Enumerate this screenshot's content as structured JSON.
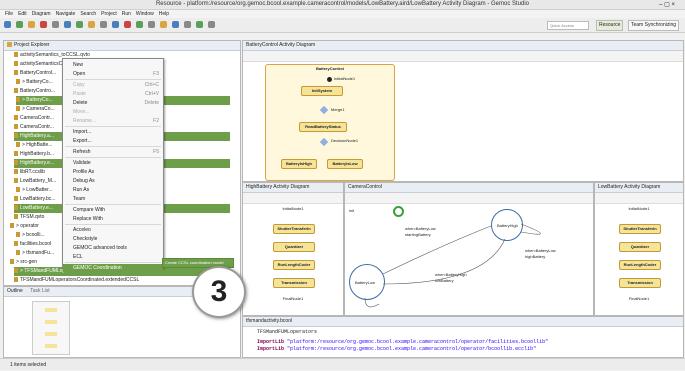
{
  "window": {
    "title": "Resource - platform:/resource/org.gemoc.bcool.example.cameracontrol/models/LowBattery.aird/LowBattery Activity Diagram - Gemoc Studio"
  },
  "menubar": [
    "File",
    "Edit",
    "Diagram",
    "Navigate",
    "Search",
    "Project",
    "Run",
    "Window",
    "Help"
  ],
  "toolbar": {
    "quick_access_placeholder": "Quick Access",
    "perspective_resource": "Resource",
    "perspective_team": "Team Synchronizing"
  },
  "project_explorer": {
    "title": "Project Explorer",
    "items": [
      "activitySemantics_toCCSL.qvto",
      "activitySemanticsCCSL.ecl",
      "BatteryControl...",
      "> BatteryCo...",
      "BatteryContro...",
      "> BatteryCo...",
      "> CameraCo...",
      "CameraContr...",
      "CameraContr...",
      "HighBattery.a...",
      "> HighBatte...",
      "HighBattery.b...",
      "HighBattery.e...",
      "libRT.ccslib",
      "LowBattery_M...",
      "> LowBatter...",
      "LowBattery.bc...",
      "LowBattery.e...",
      "TFSM.qvto",
      "> operator",
      "> bcoolli...",
      "facilities.bcool",
      "> tfsmandFu...",
      "> src-gen",
      "> TFSMandFUMLoperators.bcool",
      "TFSMandFUMLoperatorsCoordinated.extendedCCSL"
    ]
  },
  "context_menu": {
    "items": [
      {
        "label": "New",
        "shortcut": ""
      },
      {
        "label": "Open",
        "shortcut": "F3"
      },
      {
        "label": "Copy",
        "shortcut": "Ctrl+C"
      },
      {
        "label": "Paste",
        "shortcut": "Ctrl+V"
      },
      {
        "label": "Delete",
        "shortcut": "Delete"
      },
      {
        "label": "Move...",
        "shortcut": ""
      },
      {
        "label": "Rename...",
        "shortcut": "F2"
      },
      {
        "label": "Import...",
        "shortcut": ""
      },
      {
        "label": "Export...",
        "shortcut": ""
      },
      {
        "label": "Refresh",
        "shortcut": "F5"
      },
      {
        "label": "Validate",
        "shortcut": ""
      },
      {
        "label": "Profile As",
        "shortcut": ""
      },
      {
        "label": "Debug As",
        "shortcut": ""
      },
      {
        "label": "Run As",
        "shortcut": ""
      },
      {
        "label": "Team",
        "shortcut": ""
      },
      {
        "label": "Compare With",
        "shortcut": ""
      },
      {
        "label": "Replace With",
        "shortcut": ""
      },
      {
        "label": "Acceleo",
        "shortcut": ""
      },
      {
        "label": "Checkstyle",
        "shortcut": ""
      },
      {
        "label": "GEMOC advanced tools",
        "shortcut": ""
      },
      {
        "label": "ECL",
        "shortcut": ""
      },
      {
        "label": "GEMOC Coordination",
        "shortcut": ""
      }
    ],
    "submenu_item": "Create CCSL coordination model"
  },
  "outline": {
    "title": "Outline",
    "tab2": "Task List"
  },
  "editors": {
    "battery_control": {
      "tab": "BatteryControl Activity Diagram",
      "activity": "BatteryControl",
      "init_node": "InitialNode1",
      "init_system": "InitSystem",
      "merge": "Merge1",
      "read": "ReadBatteryStatus",
      "decision": "DecisionNode1",
      "high": "BatteryIsHigh",
      "low": "BatteryIsLow"
    },
    "high_battery": {
      "tab": "HighBattery Activity Diagram",
      "nodes": [
        "InitialNode1",
        "ShutterTransferIn",
        "Quantizer",
        "RunLengthCoder",
        "Transmission",
        "FinalNode1"
      ]
    },
    "camera_control": {
      "tab": "CameraControl",
      "labels": [
        "init",
        "when:BatteryLow",
        "startingBattery",
        "BatteryHigh",
        "BatteryLow",
        "when:BatteryHigh",
        "lowBattery",
        "when:BatteryLow",
        "highBattery"
      ]
    },
    "low_battery": {
      "tab": "LowBattery Activity Diagram",
      "nodes": [
        "InitialNode1",
        "ShutterTransferIn",
        "Quantizer",
        "RunLengthCoder",
        "Transmission",
        "FinalNode1"
      ]
    },
    "bcool": {
      "tab": "tfsmandactivity.bcool",
      "line1": "TFSMandFUMLoperators",
      "line2_kw": "ImportLib",
      "line2_str": "\"platform:/resource/org.gemoc.bcool.example.cameracontrol/operator/facilities.bcoollib\"",
      "line3_kw": "ImportLib",
      "line3_str": "\"platform:/resource/org.gemoc.bcool.example.cameracontrol/operator/bcoollib.ecclib\""
    }
  },
  "status": {
    "text": "1 items selected"
  },
  "overlay": {
    "number": "3"
  },
  "colors": {
    "selection": "#6e9e4a",
    "node_fill": "#f6e39a",
    "node_border": "#c59a2e",
    "state_border": "#3a6ea5"
  }
}
